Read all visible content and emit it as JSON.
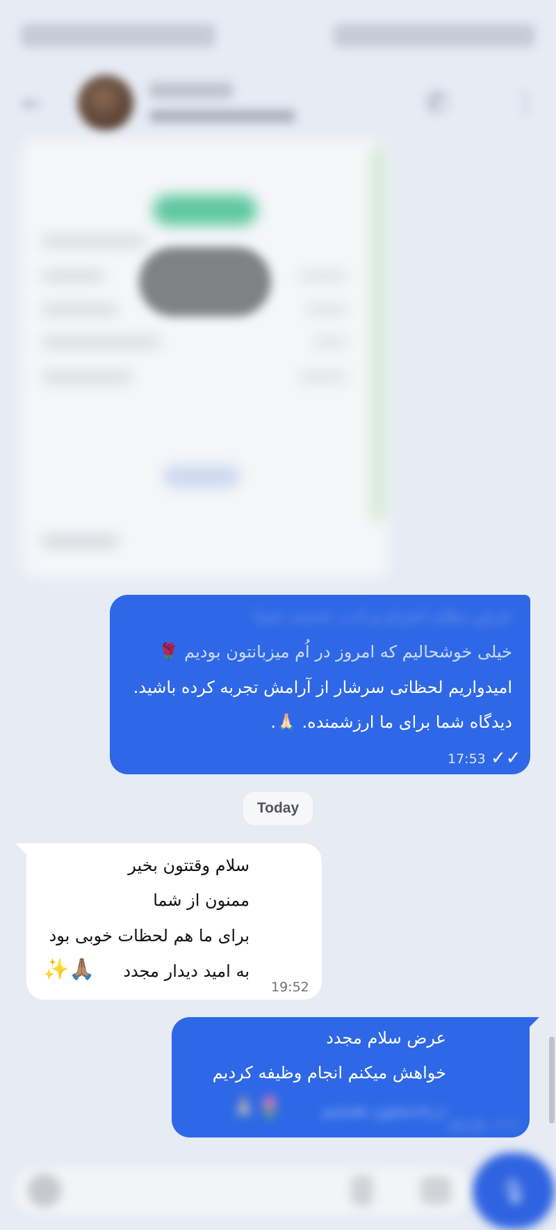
{
  "header": {
    "back_icon": "arrow-left-icon",
    "call_icon": "phone-icon",
    "more_icon": "more-vertical-icon"
  },
  "messages": {
    "out_1": {
      "line1": "عرض سلام احترام و ادب خدمت شما",
      "line2": "خیلی خوشحالیم که امروز در اُم میزبانتون بودیم 🌹",
      "line3": "امیدواریم لحظاتی سرشار از آرامش تجربه کرده باشید.",
      "line4": "دیدگاه شما برای ما ارزشمنده. 🙏🏻.",
      "time": "17:53",
      "ticks": "✓✓"
    },
    "date_chip": "Today",
    "in_1": {
      "line1": "سلام وقتتون بخیر",
      "line2": "ممنون از شما",
      "line3": "برای ما هم لحظات خوبی بود",
      "line4": "به امید دیدار مجدد",
      "emoji": "✨🙏🏽",
      "time": "19:52"
    },
    "out_2": {
      "line1": "عرض سلام مجدد",
      "line2": "خواهش میکنم انجام وظیفه کردیم",
      "line3": "درخدمتتون هستیم",
      "emoji": "🙏🏻🌷",
      "time": "20:16",
      "ticks": "✓✓"
    }
  },
  "composer": {
    "placeholder": "",
    "send_icon": "microphone-icon"
  },
  "colors": {
    "outgoing_bubble": "#2e68e6",
    "incoming_bubble": "#ffffff",
    "background": "#e6ebf4"
  }
}
